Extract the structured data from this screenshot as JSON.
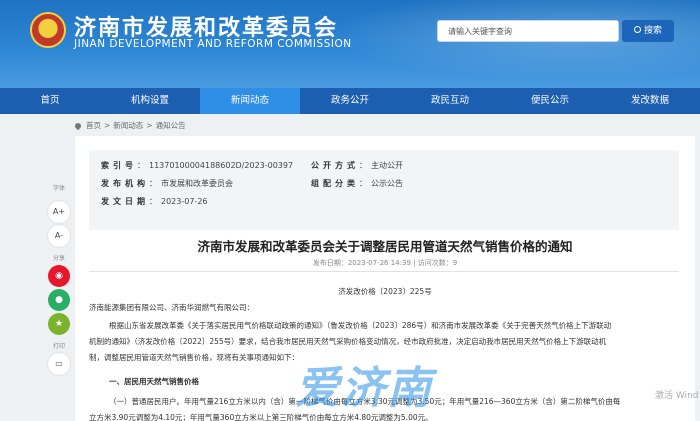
{
  "header": {
    "title": "济南市发展和改革委员会",
    "subtitle": "JINAN DEVELOPMENT AND REFORM COMMISSION",
    "search_placeholder": "请输入关键字查询",
    "search_button": "搜索"
  },
  "nav": [
    "首页",
    "机构设置",
    "新闻动态",
    "政务公开",
    "政民互动",
    "便民公示",
    "发改数据"
  ],
  "nav_active": "新闻动态",
  "breadcrumb": [
    "首页",
    "新闻动态",
    "通知公告"
  ],
  "meta": {
    "index_label": "索引号",
    "index_value": "11370100004188602D/2023-00397",
    "publish_method_label": "公开方式",
    "publish_method_value": "主动公开",
    "publisher_label": "发布机构",
    "publisher_value": "市发展和改革委员会",
    "category_label": "组配分类",
    "category_value": "公示公告",
    "date_label": "发文日期",
    "date_value": "2023-07-26"
  },
  "article": {
    "title": "济南市发展和改革委员会关于调整居民用管道天然气销售价格的通知",
    "info": "发布日期：2023-07-26 14:39 | 访问次数：9",
    "doc_no": "济发改价格〔2023〕225号",
    "recipients": "济南能源集团有限公司、济南华润燃气有限公司：",
    "para1_line1": "根据山东省发展改革委《关于落实居民用气价格联动政策的通知》（鲁发改价格〔2023〕286号）和济南市发展改革委《关于完善天然气价格上下游联动",
    "para1_line2": "机制的通知》（济发改价格〔2022〕255号）要求，结合我市居民用天然气采购价格变动情况，经市政府批准，决定启动我市居民用天然气价格上下游联动机",
    "para1_line3": "制，调整居民用管道天然气销售价格，现将有关事项通知如下：",
    "section1": "一、居民用天然气销售价格",
    "para2_line1": "（一）普通居民用户。年用气量216立方米以内（含）第一阶梯气价由每立方米3.30元调整为3.50元；年用气量216—360立方米（含）第二阶梯气价由每",
    "para2_line2": "立方米3.90元调整为4.10元；年用气量360立方米以上第三阶梯气价由每立方米4.80元调整为5.00元。"
  },
  "tools": {
    "font_label": "字体",
    "font_up": "A+",
    "font_down": "A-",
    "share_label": "分享",
    "print_label": "打印"
  },
  "watermark": "爱济南",
  "windows_notice": "激活 Wind"
}
